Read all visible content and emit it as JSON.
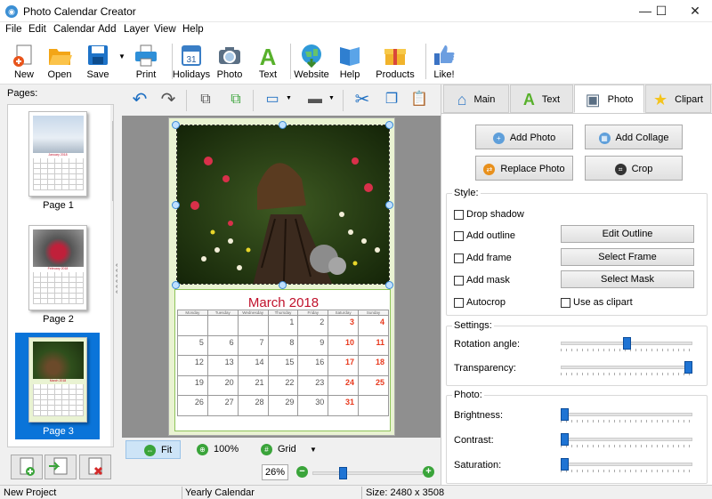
{
  "window": {
    "title": "Photo Calendar Creator"
  },
  "menu": [
    "File",
    "Edit",
    "Calendar",
    "Add",
    "Layer",
    "View",
    "Help"
  ],
  "toolbar": {
    "new": "New",
    "open": "Open",
    "save": "Save",
    "print": "Print",
    "holidays": "Holidays",
    "photo": "Photo",
    "text": "Text",
    "website": "Website",
    "help": "Help",
    "products": "Products",
    "like": "Like!"
  },
  "pages": {
    "label": "Pages:",
    "items": [
      {
        "label": "Page 1",
        "month": "January 2018"
      },
      {
        "label": "Page 2",
        "month": "February 2018"
      },
      {
        "label": "Page 3",
        "month": "March 2018"
      }
    ],
    "selected_index": 2
  },
  "calendar": {
    "title": "March 2018",
    "weekdays": [
      "Monday",
      "Tuesday",
      "Wednesday",
      "Thursday",
      "Friday",
      "Saturday",
      "Sunday"
    ],
    "rows": [
      [
        "",
        "",
        "",
        "1",
        "2",
        "3",
        "4"
      ],
      [
        "5",
        "6",
        "7",
        "8",
        "9",
        "10",
        "11"
      ],
      [
        "12",
        "13",
        "14",
        "15",
        "16",
        "17",
        "18"
      ],
      [
        "19",
        "20",
        "21",
        "22",
        "23",
        "24",
        "25"
      ],
      [
        "26",
        "27",
        "28",
        "29",
        "30",
        "31",
        ""
      ]
    ],
    "weekend_color": "#e8391d",
    "title_color": "#c0112b"
  },
  "zoom": {
    "fit": "Fit",
    "hundred": "100%",
    "grid": "Grid",
    "percent": "26%",
    "level": 0.26
  },
  "tabs": [
    {
      "label": "Main",
      "icon": "house-icon"
    },
    {
      "label": "Text",
      "icon": "text-a-icon"
    },
    {
      "label": "Photo",
      "icon": "camera-icon"
    },
    {
      "label": "Clipart",
      "icon": "star-icon"
    }
  ],
  "active_tab": "Photo",
  "photoTab": {
    "add_photo": "Add Photo",
    "add_collage": "Add Collage",
    "replace_photo": "Replace Photo",
    "crop": "Crop",
    "style": {
      "title": "Style:",
      "drop_shadow": "Drop shadow",
      "add_outline": "Add outline",
      "add_frame": "Add frame",
      "add_mask": "Add mask",
      "autocrop": "Autocrop",
      "use_as_clipart": "Use as clipart",
      "edit_outline": "Edit Outline",
      "select_frame": "Select Frame",
      "select_mask": "Select Mask"
    },
    "settings": {
      "title": "Settings:",
      "rotation": "Rotation angle:",
      "rotation_value": 0.5,
      "transparency": "Transparency:",
      "transparency_value": 1.0
    },
    "photo": {
      "title": "Photo:",
      "brightness": "Brightness:",
      "brightness_value": 0.0,
      "contrast": "Contrast:",
      "contrast_value": 0.0,
      "saturation": "Saturation:",
      "saturation_value": 0.0
    }
  },
  "status": {
    "project": "New Project",
    "type": "Yearly Calendar",
    "size": "Size: 2480 x 3508"
  }
}
